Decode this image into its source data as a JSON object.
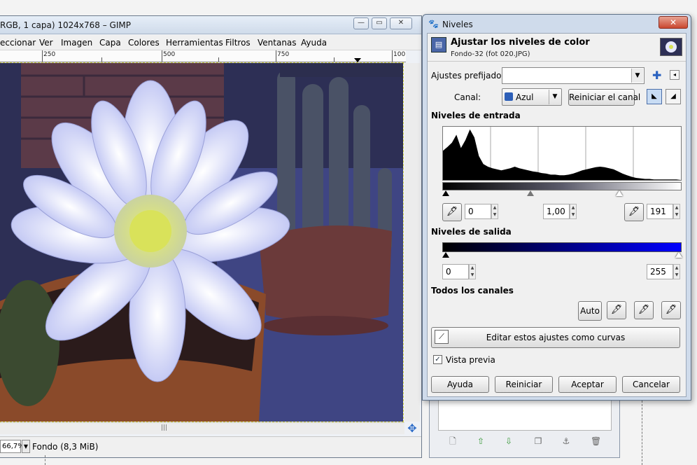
{
  "gimp": {
    "title": "RGB, 1 capa) 1024x768 – GIMP",
    "menu": [
      "eccionar",
      "Ver",
      "Imagen",
      "Capa",
      "Colores",
      "Herramientas",
      "Filtros",
      "Ventanas",
      "Ayuda"
    ],
    "ruler_labels": [
      "250",
      "500",
      "750",
      "100"
    ],
    "zoom": "66,7%",
    "status": "Fondo (8,3 MiB)"
  },
  "niveles": {
    "window_title": "Niveles",
    "header_title": "Ajustar los niveles de color",
    "header_subtitle": "Fondo-32 (fot 020.JPG)",
    "presets_label": "Ajustes prefijados:",
    "presets_value": "",
    "channel_label": "Canal:",
    "channel_value": "Azul",
    "reset_channel_button": "Reiniciar el canal",
    "input_levels_title": "Niveles de entrada",
    "input_low": "0",
    "input_gamma": "1,00",
    "input_high": "191",
    "output_levels_title": "Niveles de salida",
    "output_low": "0",
    "output_high": "255",
    "all_channels_title": "Todos los canales",
    "auto_button": "Auto",
    "edit_curves_button": "Editar estos ajustes como curvas",
    "preview_label": "Vista previa",
    "preview_checked": true,
    "buttons": {
      "help": "Ayuda",
      "reset": "Reiniciar",
      "ok": "Aceptar",
      "cancel": "Cancelar"
    },
    "histogram_blue": [
      0.55,
      0.62,
      0.7,
      0.85,
      0.6,
      0.75,
      0.95,
      0.8,
      0.45,
      0.3,
      0.25,
      0.22,
      0.2,
      0.18,
      0.2,
      0.22,
      0.25,
      0.22,
      0.2,
      0.18,
      0.16,
      0.15,
      0.13,
      0.12,
      0.1,
      0.1,
      0.09,
      0.09,
      0.1,
      0.12,
      0.15,
      0.18,
      0.2,
      0.22,
      0.24,
      0.25,
      0.24,
      0.22,
      0.2,
      0.16,
      0.12,
      0.09,
      0.06,
      0.04,
      0.03,
      0.02,
      0.02,
      0.01,
      0.01,
      0.01,
      0.01,
      0.01,
      0.01,
      0.0
    ]
  }
}
